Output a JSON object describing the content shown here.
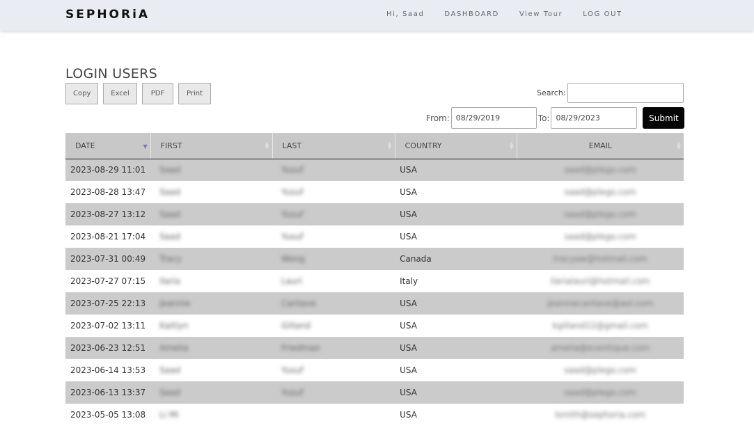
{
  "header": {
    "brand": "SEPHORiA",
    "nav": [
      "Hi, Saad",
      "DASHBOARD",
      "View Tour",
      "LOG OUT"
    ]
  },
  "page": {
    "title": "LOGIN USERS"
  },
  "toolbar": {
    "copy_label": "Copy",
    "excel_label": "Excel",
    "pdf_label": "PDF",
    "print_label": "Print",
    "search_label": "Search:",
    "search_value": ""
  },
  "filter": {
    "from_label": "From:",
    "from_value": "08/29/2019",
    "to_label": "To:",
    "to_value": "08/29/2023",
    "submit_label": "Submit"
  },
  "table": {
    "columns": [
      "DATE",
      "FIRST",
      "LAST",
      "COUNTRY",
      "EMAIL"
    ],
    "sorted_column": "DATE",
    "sort_direction": "desc",
    "rows": [
      {
        "date": "2023-08-29 11:01",
        "first": "Saad",
        "last": "Yusuf",
        "country": "USA",
        "email": "saad@plego.com"
      },
      {
        "date": "2023-08-28 13:47",
        "first": "Saad",
        "last": "Yusuf",
        "country": "USA",
        "email": "saad@plego.com"
      },
      {
        "date": "2023-08-27 13:12",
        "first": "Saad",
        "last": "Yusuf",
        "country": "USA",
        "email": "saad@plego.com"
      },
      {
        "date": "2023-08-21 17:04",
        "first": "Saad",
        "last": "Yusuf",
        "country": "USA",
        "email": "saad@plego.com"
      },
      {
        "date": "2023-07-31 00:49",
        "first": "Tracy",
        "last": "Wong",
        "country": "Canada",
        "email": "tracyaw@hotmail.com"
      },
      {
        "date": "2023-07-27 07:15",
        "first": "Ilaria",
        "last": "Lauri",
        "country": "Italy",
        "email": "ilarialauri@hotmail.com"
      },
      {
        "date": "2023-07-25 22:13",
        "first": "Jeannie",
        "last": "Cantave",
        "country": "USA",
        "email": "jeanniecantave@aol.com"
      },
      {
        "date": "2023-07-02 13:11",
        "first": "Kaitlyn",
        "last": "Gilland",
        "country": "USA",
        "email": "kgilland12@gmail.com"
      },
      {
        "date": "2023-06-23 12:51",
        "first": "Amelia",
        "last": "Friedman",
        "country": "USA",
        "email": "amelia@eventique.com"
      },
      {
        "date": "2023-06-14 13:53",
        "first": "Saad",
        "last": "Yusuf",
        "country": "USA",
        "email": "saad@plego.com"
      },
      {
        "date": "2023-06-13 13:37",
        "first": "Saad",
        "last": "Yusuf",
        "country": "USA",
        "email": "saad@plego.com"
      },
      {
        "date": "2023-05-05 13:08",
        "first": "Li Mi",
        "last": "",
        "country": "USA",
        "email": "lsmith@sephoria.com"
      }
    ]
  }
}
